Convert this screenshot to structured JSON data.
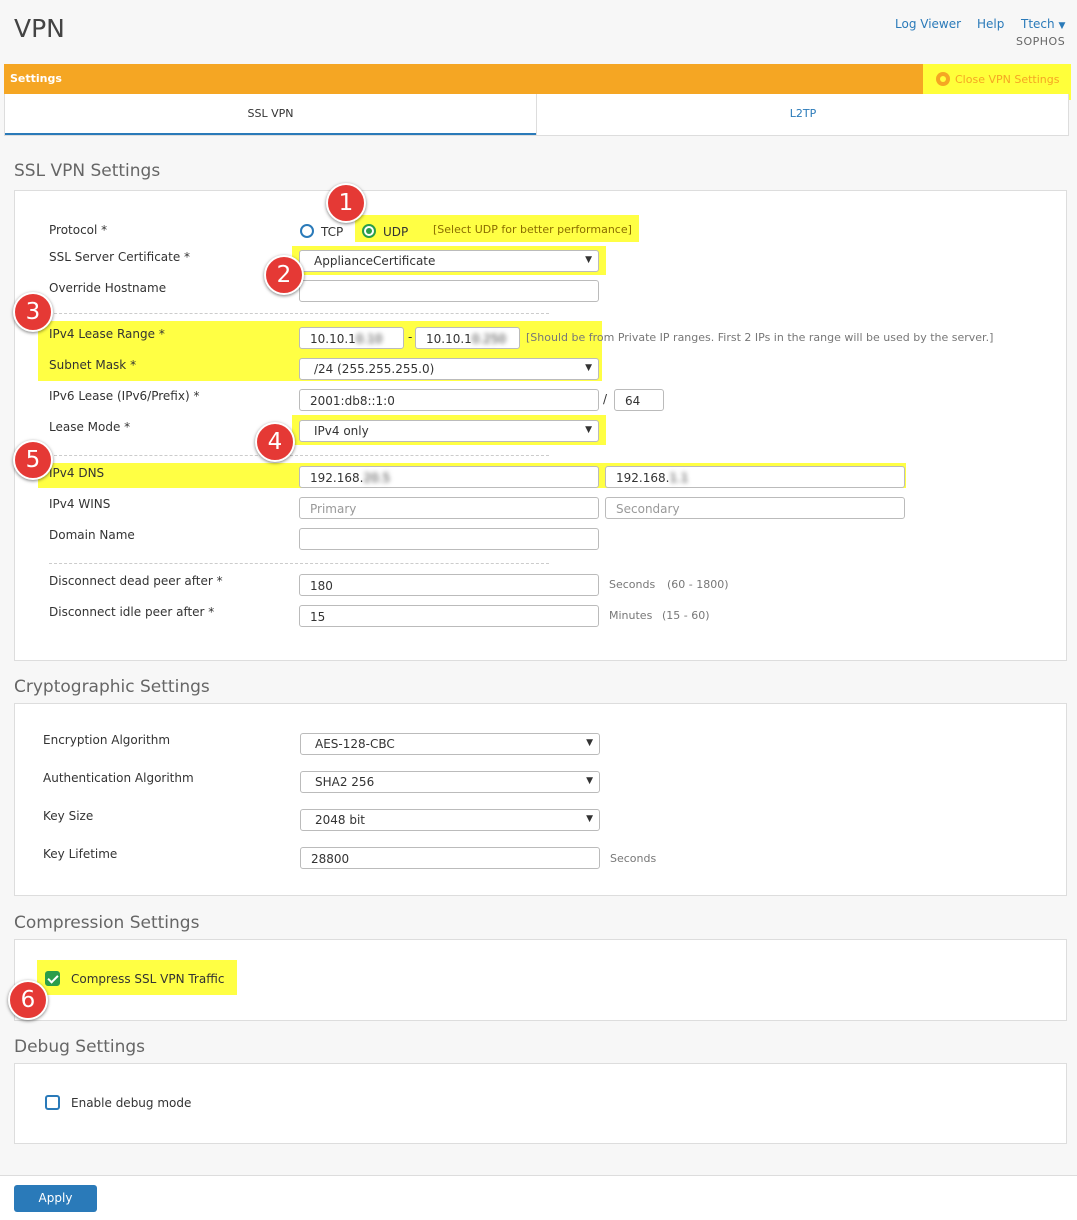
{
  "page": {
    "title": "VPN"
  },
  "header": {
    "log_viewer": "Log Viewer",
    "help": "Help",
    "user": "Ttech",
    "brand": "SOPHOS"
  },
  "settings_bar": {
    "label": "Settings",
    "close_label": "Close VPN Settings"
  },
  "tabs": [
    {
      "label": "SSL VPN",
      "active": true
    },
    {
      "label": "L2TP",
      "active": false
    }
  ],
  "ssl": {
    "section_title": "SSL VPN Settings",
    "protocol": {
      "label": "Protocol *",
      "opt_tcp": "TCP",
      "opt_udp": "UDP",
      "selected": "UDP",
      "hint": "[Select UDP for better performance]"
    },
    "cert": {
      "label": "SSL Server Certificate *",
      "value": "ApplianceCertificate"
    },
    "override": {
      "label": "Override Hostname",
      "value": ""
    },
    "lease_range": {
      "label": "IPv4 Lease Range *",
      "start": "10.10.1",
      "start_hidden": "0.10",
      "sep": "-",
      "end": "10.10.1",
      "end_hidden": "0.250",
      "hint": "[Should be from Private IP ranges. First 2 IPs in the range will be used by the server.]"
    },
    "subnet": {
      "label": "Subnet Mask *",
      "value": "/24 (255.255.255.0)"
    },
    "ipv6": {
      "label": "IPv6 Lease (IPv6/Prefix) *",
      "value": "2001:db8::1:0",
      "slash": "/",
      "prefix": "64"
    },
    "lease_mode": {
      "label": "Lease Mode *",
      "value": "IPv4 only"
    },
    "dns": {
      "label": "IPv4 DNS",
      "primary": "192.168.",
      "primary_hidden": "20.5",
      "secondary": "192.168.",
      "secondary_hidden": "1.1"
    },
    "wins": {
      "label": "IPv4 WINS",
      "primary_placeholder": "Primary",
      "secondary_placeholder": "Secondary"
    },
    "domain": {
      "label": "Domain Name",
      "value": ""
    },
    "dead_peer": {
      "label": "Disconnect dead peer after *",
      "value": "180",
      "unit": "Seconds",
      "range": "(60 - 1800)"
    },
    "idle_peer": {
      "label": "Disconnect idle peer after *",
      "value": "15",
      "unit": "Minutes",
      "range": "(15 - 60)"
    }
  },
  "crypto": {
    "section_title": "Cryptographic Settings",
    "enc": {
      "label": "Encryption Algorithm",
      "value": "AES-128-CBC"
    },
    "auth": {
      "label": "Authentication Algorithm",
      "value": "SHA2 256"
    },
    "key_size": {
      "label": "Key Size",
      "value": "2048 bit"
    },
    "key_lifetime": {
      "label": "Key Lifetime",
      "value": "28800",
      "unit": "Seconds"
    }
  },
  "compression": {
    "section_title": "Compression Settings",
    "label": "Compress SSL VPN Traffic",
    "checked": true
  },
  "debug": {
    "section_title": "Debug Settings",
    "label": "Enable debug mode",
    "checked": false
  },
  "footer": {
    "apply": "Apply"
  },
  "badges": [
    "1",
    "2",
    "3",
    "4",
    "5",
    "6"
  ],
  "colors": {
    "accent": "#2a7ab9",
    "orange": "#f5a623",
    "highlight": "#ffff44",
    "badge": "#e53935",
    "check": "#2a9d4a"
  }
}
